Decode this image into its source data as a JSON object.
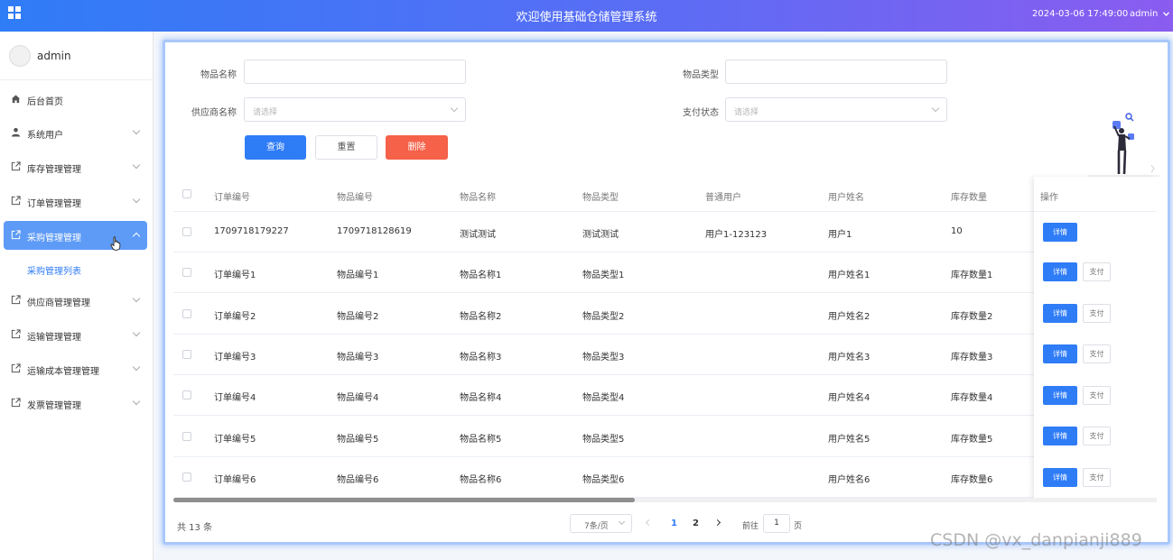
{
  "header": {
    "title": "欢迎使用基础仓储管理系统",
    "datetime": "2024-03-06 17:49:00",
    "user": "admin"
  },
  "sidebar": {
    "username": "admin",
    "items": [
      {
        "label": "后台首页",
        "icon": "home-icon"
      },
      {
        "label": "系统用户",
        "icon": "user-icon"
      },
      {
        "label": "库存管理管理",
        "icon": "external-link-icon"
      },
      {
        "label": "订单管理管理",
        "icon": "external-link-icon"
      },
      {
        "label": "采购管理管理",
        "icon": "external-link-icon"
      },
      {
        "label": "供应商管理管理",
        "icon": "external-link-icon"
      },
      {
        "label": "运输管理管理",
        "icon": "external-link-icon"
      },
      {
        "label": "运输成本管理管理",
        "icon": "external-link-icon"
      },
      {
        "label": "发票管理管理",
        "icon": "external-link-icon"
      }
    ],
    "submenu_label": "采购管理列表"
  },
  "filters": {
    "item_name_label": "物品名称",
    "item_type_label": "物品类型",
    "supplier_label": "供应商名称",
    "supplier_placeholder": "请选择",
    "pay_status_label": "支付状态",
    "pay_status_placeholder": "请选择",
    "query_label": "查询",
    "reset_label": "重置",
    "delete_label": "删除"
  },
  "table": {
    "headers": [
      "订单编号",
      "物品编号",
      "物品名称",
      "物品类型",
      "普通用户",
      "用户姓名",
      "库存数量"
    ],
    "action_header": "操作",
    "detail_label": "详情",
    "pay_label": "支付",
    "rows": [
      [
        "1709718179227",
        "1709718128619",
        "测试测试",
        "测试测试",
        "用户1-123123",
        "用户1",
        "10"
      ],
      [
        "订单编号1",
        "物品编号1",
        "物品名称1",
        "物品类型1",
        "",
        "用户姓名1",
        "库存数量1"
      ],
      [
        "订单编号2",
        "物品编号2",
        "物品名称2",
        "物品类型2",
        "",
        "用户姓名2",
        "库存数量2"
      ],
      [
        "订单编号3",
        "物品编号3",
        "物品名称3",
        "物品类型3",
        "",
        "用户姓名3",
        "库存数量3"
      ],
      [
        "订单编号4",
        "物品编号4",
        "物品名称4",
        "物品类型4",
        "",
        "用户姓名4",
        "库存数量4"
      ],
      [
        "订单编号5",
        "物品编号5",
        "物品名称5",
        "物品类型5",
        "",
        "用户姓名5",
        "库存数量5"
      ],
      [
        "订单编号6",
        "物品编号6",
        "物品名称6",
        "物品类型6",
        "",
        "用户姓名6",
        "库存数量6"
      ]
    ]
  },
  "pagination": {
    "total": "共 13 条",
    "page_size": "7条/页",
    "pages": [
      "1",
      "2"
    ],
    "goto_label": "前往",
    "goto_value": "1",
    "page_suffix": "页"
  },
  "watermark": "CSDN @vx_danpianji889",
  "colors": {
    "primary": "#2f7cf7",
    "danger": "#f56149",
    "active_menu": "#5e9bf6",
    "header_gradient_end": "#8a5cf0"
  }
}
